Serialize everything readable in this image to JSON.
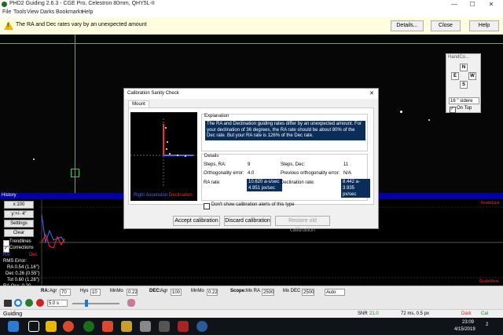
{
  "app": {
    "title": "PHD2 Guiding 2.6.3 - CGE Pro, Celestron 80mm, QHY5L-II",
    "minimize": "—",
    "maximize": "☐",
    "close": "✕"
  },
  "menu": [
    "File",
    "Tools",
    "View",
    "Darks",
    "Bookmarks",
    "Help"
  ],
  "alert": {
    "message": "The RA and Dec rates vary by an unexpected amount",
    "details_btn": "Details...",
    "close_btn": "Close",
    "help_btn": "Help"
  },
  "handcontrol": {
    "title": "HandCo...",
    "n": "N",
    "e": "E",
    "w": "W",
    "s": "S",
    "speed": "16 \" sidere",
    "ontop": "On Top"
  },
  "dialog": {
    "title": "Calibration Sanity Check",
    "close": "✕",
    "tab": "Mount",
    "legend_ra": "Right Ascension",
    "legend_dec": "Declination",
    "explanation_label": "Explanation",
    "explanation": "The RA and Declination guiding rates differ by an unexpected amount.  For your declination of 36 degrees, the RA rate should be about 80% of the Dec rate.  But your RA rate is 126% of the Dec rate.",
    "details_label": "Details",
    "steps_ra_label": "Steps, RA:",
    "steps_ra": "9",
    "steps_dec_label": "Steps, Dec:",
    "steps_dec": "11",
    "ortho_label": "Orthogonality error:",
    "ortho": "4.0",
    "prev_ortho_label": "Previous orthogonality error:",
    "prev_ortho": "N/A",
    "ra_rate_label": "RA rate:",
    "ra_rate_1": "10.620 a-s/sec",
    "ra_rate_2": "4.951 px/sec",
    "dec_rate_label": "Declination rate:",
    "dec_rate_1": "8.442 a-s/sec",
    "dec_rate_2": "3.935 px/sec",
    "dont_show": "Don't show calibration alerts of this type",
    "accept": "Accept calibration",
    "discard": "Discard calibration",
    "restore": "Restore old calibration"
  },
  "history": {
    "title": "History",
    "x_btn": "x:100",
    "y_btn": "y:+/- 4\"",
    "settings_btn": "Settings",
    "clear_btn": "Clear",
    "trendlines": "Trendlines",
    "corrections": "Corrections",
    "ra": "RA",
    "dec": "Dec",
    "rms_label": "RMS Error:",
    "ra_rms": "RA 0.54 (1.16\")",
    "dec_rms": "Dec 0.26 (0.55\")",
    "tot_rms": "Tot 0.60 (1.28\")",
    "ra_osc": "RA Osc: 0.20",
    "guide_east": "GuideEast",
    "guide_west": "GuideWest"
  },
  "params": {
    "ra_label": "RA:",
    "ra_algo": "Agr",
    "ra_agr": "70",
    "hys_label": "Hys",
    "hys": "10",
    "mnmo_label": "MnMo",
    "mnmo": "0.22",
    "dec_label": "DEC:",
    "dec_algo": "Agr",
    "dec_agr": "100",
    "dec_mnmo_label": "MnMo",
    "dec_mnmo": "0.22",
    "scope_label": "Scope:",
    "mxra_label": "Mx RA",
    "mxra": "2500",
    "mxdec_label": "Mx DEC",
    "mxdec": "2500",
    "auto": "Auto"
  },
  "toolbar": {
    "exposure": "5.0 s"
  },
  "status": {
    "state": "Guiding",
    "snr_label": "SNR",
    "snr": "21.0",
    "ms": "72 ms, 0.5 px",
    "dark": "Dark",
    "cal": "Cal"
  },
  "taskbar": {
    "time": "23:09",
    "date": "4/15/2019",
    "badge": "2"
  },
  "colors": {
    "accent_blue": "#0a2d5a",
    "guide_green": "#2bd62b",
    "ra_blue": "#4a6cff",
    "dec_red": "#ff2a2a"
  }
}
